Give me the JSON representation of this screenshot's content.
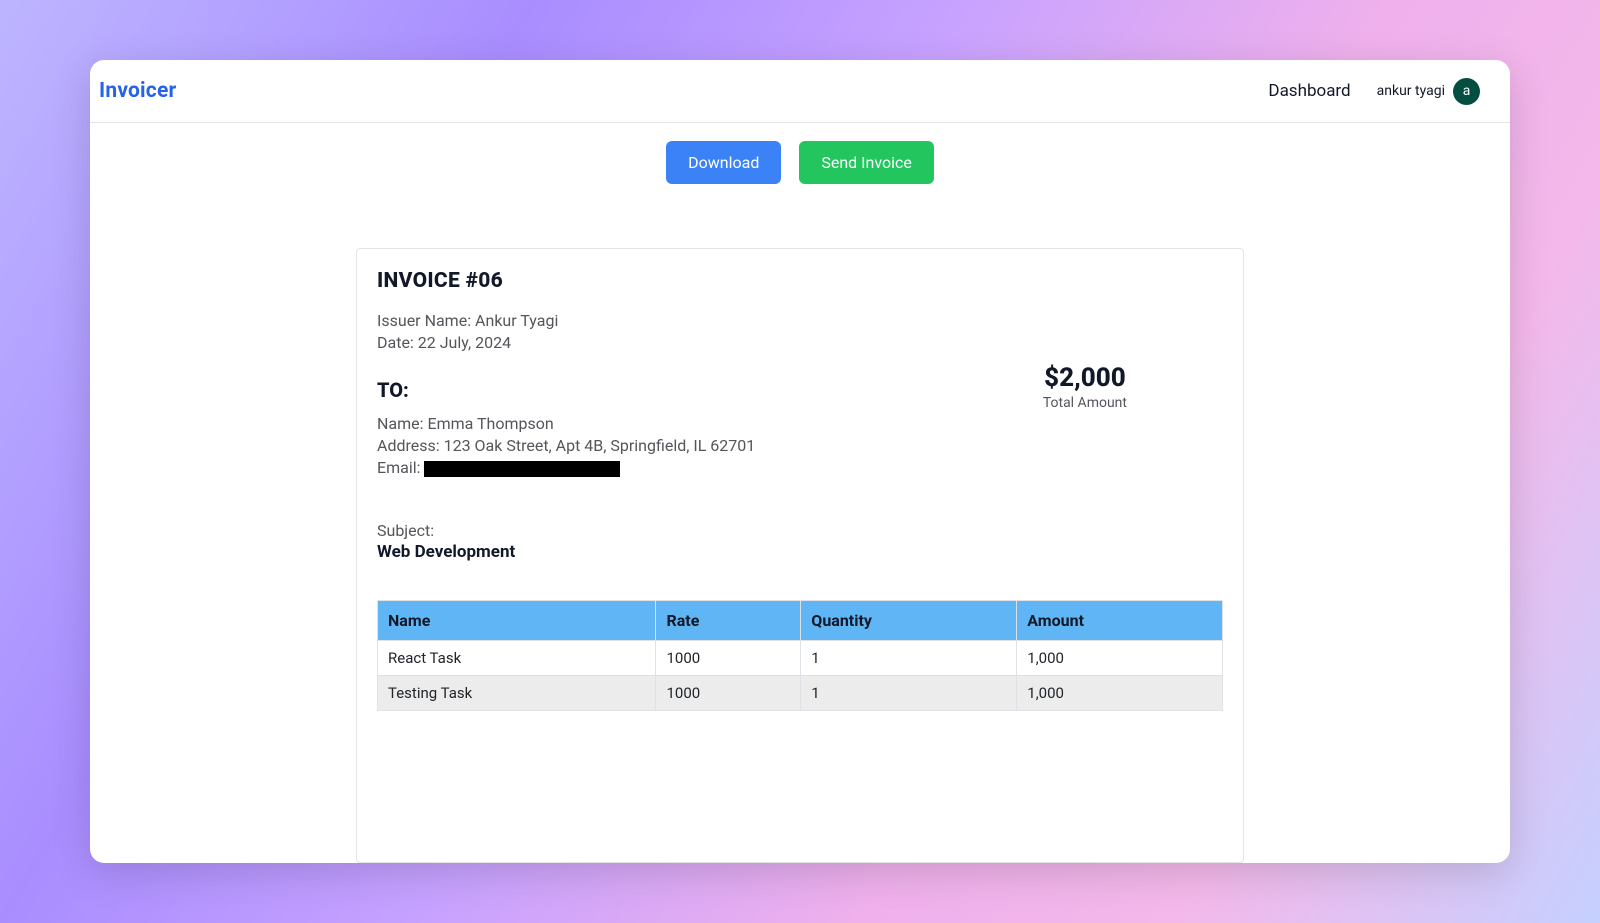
{
  "nav": {
    "brand": "Invoicer",
    "dashboard": "Dashboard",
    "user_name": "ankur tyagi",
    "avatar_letter": "a"
  },
  "actions": {
    "download": "Download",
    "send": "Send Invoice"
  },
  "invoice": {
    "title": "INVOICE #06",
    "issuer_line": "Issuer Name: Ankur Tyagi",
    "date_line": "Date: 22 July, 2024",
    "to_heading": "TO:",
    "to_name": "Name: Emma Thompson",
    "to_address": "Address: 123 Oak Street, Apt 4B, Springfield, IL 62701",
    "to_email_label": "Email:",
    "subject_label": "Subject:",
    "subject_value": "Web Development",
    "total_amount": "$2,000",
    "total_label": "Total Amount"
  },
  "table": {
    "headers": {
      "name": "Name",
      "rate": "Rate",
      "qty": "Quantity",
      "amount": "Amount"
    },
    "rows": [
      {
        "name": "React Task",
        "rate": "1000",
        "qty": "1",
        "amount": "1,000"
      },
      {
        "name": "Testing Task",
        "rate": "1000",
        "qty": "1",
        "amount": "1,000"
      }
    ]
  }
}
